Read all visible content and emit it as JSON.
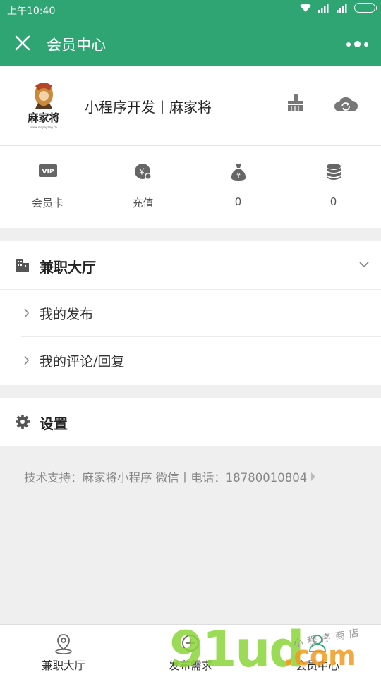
{
  "status_bar": {
    "time": "上午10:40"
  },
  "nav": {
    "title": "会员中心"
  },
  "profile": {
    "name": "小程序开发丨麻家将",
    "logo_text": "麻家将"
  },
  "stats": [
    {
      "icon": "vip-card-icon",
      "label": "会员卡"
    },
    {
      "icon": "recharge-coin-icon",
      "label": "充值"
    },
    {
      "icon": "money-bag-icon",
      "label": "0"
    },
    {
      "icon": "coin-stack-icon",
      "label": "0"
    }
  ],
  "part_time": {
    "title": "兼职大厅",
    "items": [
      {
        "label": "我的发布"
      },
      {
        "label": "我的评论/回复"
      }
    ]
  },
  "settings": {
    "title": "设置"
  },
  "support": {
    "text": "技术支持：麻家将小程序 微信丨电话：18780010804"
  },
  "tabbar": [
    {
      "label": "兼职大厅",
      "icon": "location-pin-icon"
    },
    {
      "label": "发布需求",
      "icon": "add-circle-icon"
    },
    {
      "label": "会员中心",
      "icon": "user-icon"
    }
  ],
  "watermark": {
    "big": "91ud",
    "com": ".com",
    "small": "小程序商店"
  },
  "colors": {
    "brand_green": "#2fa573",
    "background": "#efefef",
    "icon_gray": "#666666"
  }
}
